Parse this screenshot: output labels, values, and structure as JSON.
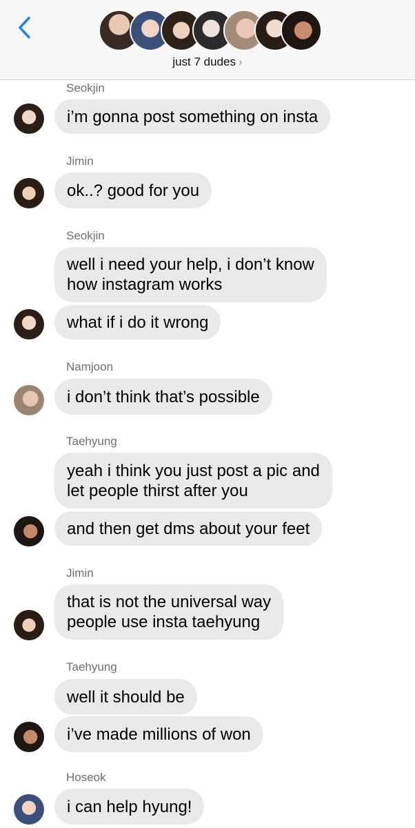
{
  "header": {
    "group_name": "just 7 dudes",
    "chevron": "›",
    "member_avatars": [
      "avatar-1",
      "avatar-2",
      "avatar-3",
      "avatar-4",
      "avatar-5",
      "avatar-6",
      "avatar-7"
    ]
  },
  "messages": [
    {
      "sender": "Seokjin",
      "lines": [
        "i’m gonna post something on insta"
      ]
    },
    {
      "sender": "Jimin",
      "lines": [
        "ok..? good for you"
      ]
    },
    {
      "sender": "Seokjin",
      "lines": [
        "well i need your help, i don’t know",
        "how instagram works"
      ]
    },
    {
      "sender": "",
      "lines": [
        "what if i do it wrong"
      ]
    },
    {
      "sender": "Namjoon",
      "lines": [
        "i don’t think that’s possible"
      ]
    },
    {
      "sender": "Taehyung",
      "lines": [
        "yeah i think you just post a pic and",
        "let people thirst after you"
      ]
    },
    {
      "sender": "",
      "lines": [
        "and then get dms about your feet"
      ]
    },
    {
      "sender": "Jimin",
      "lines": [
        "that is not the universal way",
        "people use insta taehyung"
      ]
    },
    {
      "sender": "Taehyung",
      "lines": [
        "well it should be"
      ]
    },
    {
      "sender": "",
      "lines": [
        "i’ve made millions of won"
      ]
    },
    {
      "sender": "Hoseok",
      "lines": [
        "i can help hyung!"
      ]
    }
  ],
  "colors": {
    "bubble": "#e9e9eb",
    "header_bg": "#f7f7f7",
    "accent": "#1a84ff",
    "sender_text": "#6e6e73"
  }
}
